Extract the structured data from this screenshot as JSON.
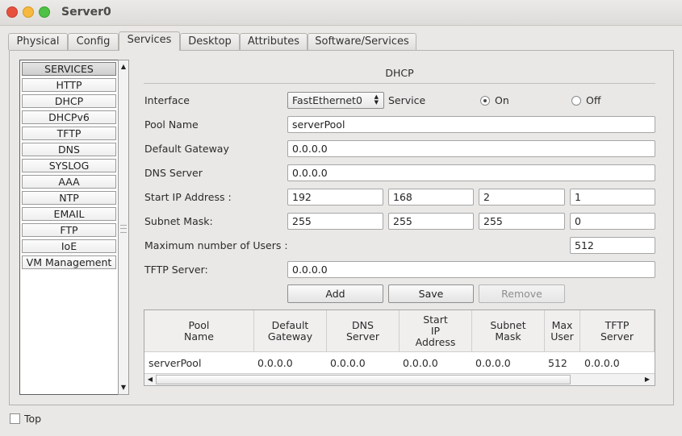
{
  "window": {
    "title": "Server0"
  },
  "tabs": [
    "Physical",
    "Config",
    "Services",
    "Desktop",
    "Attributes",
    "Software/Services"
  ],
  "services": {
    "header": "SERVICES",
    "items": [
      "HTTP",
      "DHCP",
      "DHCPv6",
      "TFTP",
      "DNS",
      "SYSLOG",
      "AAA",
      "NTP",
      "EMAIL",
      "FTP",
      "IoE",
      "VM Management"
    ]
  },
  "dhcp": {
    "title": "DHCP",
    "interface_label": "Interface",
    "interface_value": "FastEthernet0",
    "service_label": "Service",
    "on_label": "On",
    "off_label": "Off",
    "service_state": "On",
    "pool_name_label": "Pool Name",
    "pool_name": "serverPool",
    "gateway_label": "Default Gateway",
    "gateway": "0.0.0.0",
    "dns_label": "DNS Server",
    "dns": "0.0.0.0",
    "start_ip_label": "Start IP Address :",
    "start_ip": [
      "192",
      "168",
      "2",
      "1"
    ],
    "subnet_label": "Subnet Mask:",
    "subnet": [
      "255",
      "255",
      "255",
      "0"
    ],
    "max_users_label": "Maximum number of Users :",
    "max_users": "512",
    "tftp_label": "TFTP Server:",
    "tftp": "0.0.0.0",
    "buttons": {
      "add": "Add",
      "save": "Save",
      "remove": "Remove"
    }
  },
  "table": {
    "columns": [
      "Pool\nName",
      "Default\nGateway",
      "DNS\nServer",
      "Start\nIP\nAddress",
      "Subnet\nMask",
      "Max\nUser",
      "TFTP\nServer"
    ],
    "rows": [
      [
        "serverPool",
        "0.0.0.0",
        "0.0.0.0",
        "0.0.0.0",
        "0.0.0.0",
        "512",
        "0.0.0.0"
      ]
    ]
  },
  "footer": {
    "top_label": "Top",
    "top_checked": false
  },
  "colors": {
    "close": "#e8503e",
    "minimize": "#f6b83e",
    "maximize": "#4fc146"
  },
  "icons": [
    "close-icon",
    "minimize-icon",
    "maximize-icon",
    "spinner-icon",
    "arrow-up-icon",
    "arrow-down-icon",
    "arrow-left-icon",
    "arrow-right-icon"
  ]
}
